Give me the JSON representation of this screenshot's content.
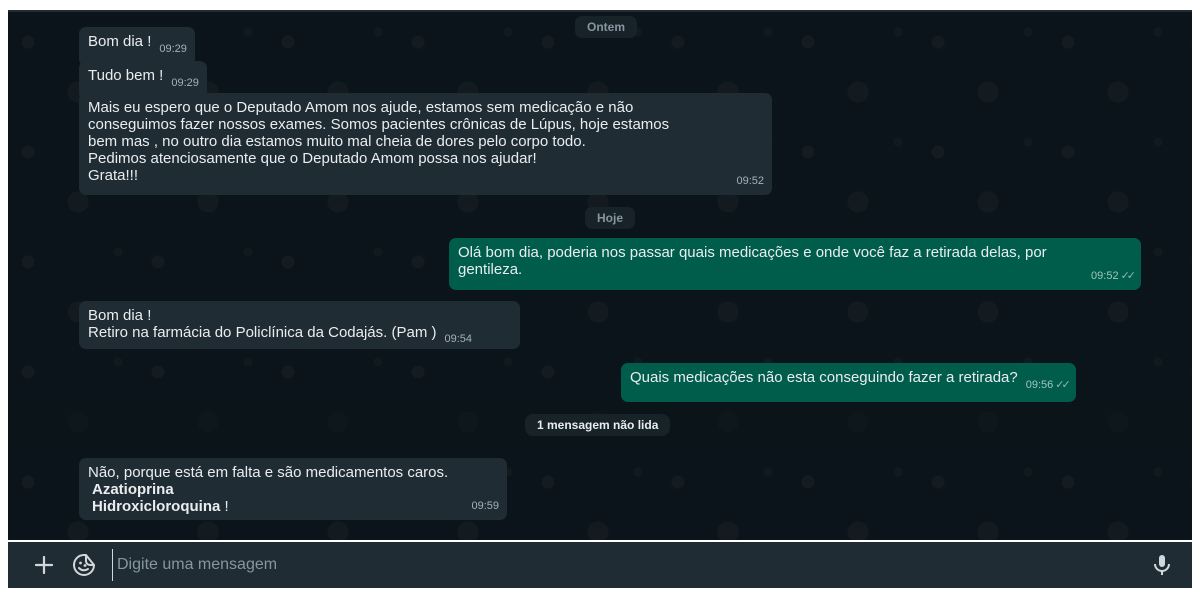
{
  "chat": {
    "date_yesterday": "Ontem",
    "date_today": "Hoje",
    "unread_label": "1 mensagem não lida",
    "messages": [
      {
        "text": "Bom dia !",
        "time": "09:29"
      },
      {
        "text": "Tudo bem !",
        "time": "09:29"
      },
      {
        "text": "Mais eu espero que o Deputado Amom nos ajude, estamos sem medicação e não\nconseguimos fazer nossos exames. Somos pacientes crônicas de Lúpus, hoje estamos\nbem mas , no outro dia estamos muito mal cheia de dores pelo corpo todo.\nPedimos atenciosamente que o Deputado Amom possa nos ajudar!\nGrata!!!",
        "time": "09:52"
      },
      {
        "text": "Olá bom dia, poderia nos passar quais medicações e onde você faz a retirada delas, por\ngentileza.",
        "time": "09:52"
      },
      {
        "text": "Bom dia !\nRetiro na farmácia do Policlínica da Codajás. (Pam )",
        "time": "09:54"
      },
      {
        "text": "Quais medicações não esta conseguindo fazer a retirada?",
        "time": "09:56"
      },
      {
        "text": "Não, porque está em falta  e são medicamentos caros.",
        "bold1": "Azatioprina",
        "bold2": "Hidroxicloroquina",
        "suffix2": " !",
        "time": "09:59"
      }
    ]
  },
  "composer": {
    "placeholder": "Digite uma mensagem",
    "icons": [
      "plus-icon",
      "sticker-icon",
      "microphone-icon"
    ]
  },
  "colors": {
    "background": "#0b141a",
    "incoming_bubble": "#202c33",
    "outgoing_bubble": "#005c4b",
    "composer": "#202c33"
  }
}
